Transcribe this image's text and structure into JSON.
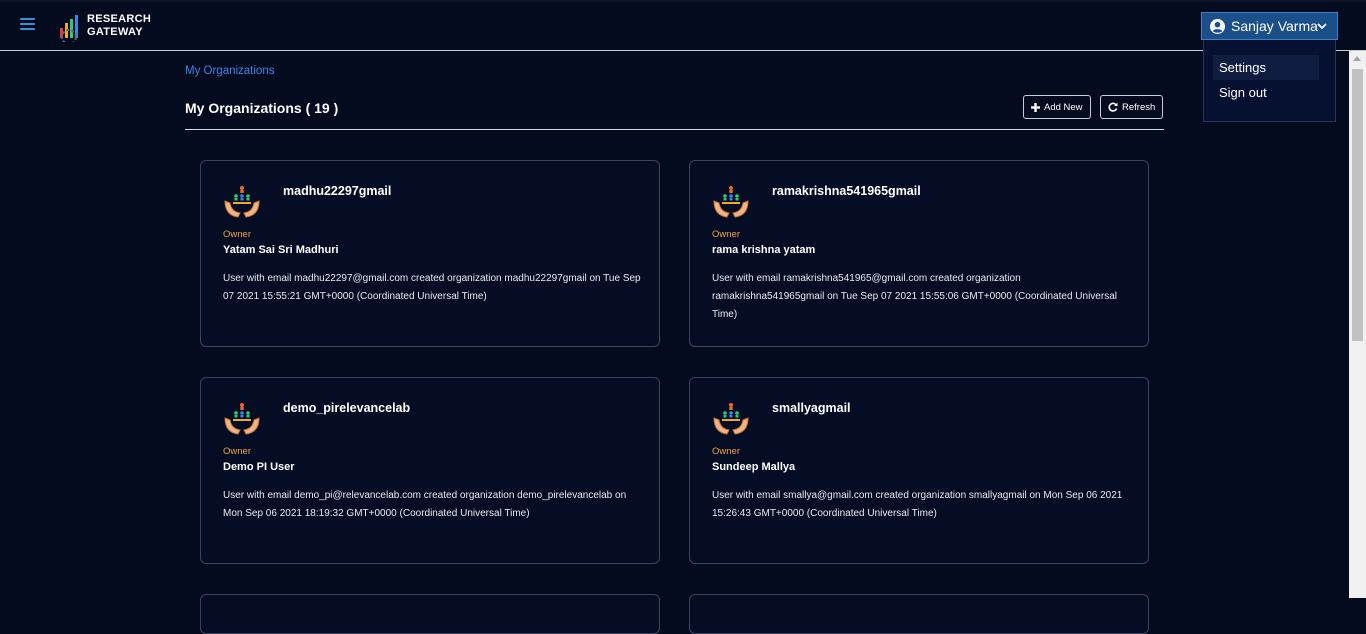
{
  "header": {
    "logo_line1": "RESEARCH",
    "logo_line2": "GATEWAY",
    "user_name": "Sanjay Varma",
    "menu_icon": "hamburger-menu-icon",
    "user_icon": "user-circle-icon"
  },
  "user_menu": {
    "items": [
      "Settings",
      "Sign out"
    ]
  },
  "breadcrumb": "My Organizations",
  "page_title": "My Organizations ( 19 )",
  "toolbar": {
    "add_label": "Add New",
    "refresh_label": "Refresh"
  },
  "organizations": [
    {
      "name": "madhu22297gmail",
      "role": "Owner",
      "owner": "Yatam Sai Sri Madhuri",
      "description": "User with email madhu22297@gmail.com created organization madhu22297gmail on Tue Sep 07 2021 15:55:21 GMT+0000 (Coordinated Universal Time)"
    },
    {
      "name": "ramakrishna541965gmail",
      "role": "Owner",
      "owner": "rama krishna yatam",
      "description": "User with email ramakrishna541965@gmail.com created organization ramakrishna541965gmail on Tue Sep 07 2021 15:55:06 GMT+0000 (Coordinated Universal Time)"
    },
    {
      "name": "demo_pirelevancelab",
      "role": "Owner",
      "owner": "Demo PI User",
      "description": "User with email demo_pi@relevancelab.com created organization demo_pirelevancelab on Mon Sep 06 2021 18:19:32 GMT+0000 (Coordinated Universal Time)"
    },
    {
      "name": "smallyagmail",
      "role": "Owner",
      "owner": "Sundeep Mallya",
      "description": "User with email smallya@gmail.com created organization smallyagmail on Mon Sep 06 2021 15:26:43 GMT+0000 (Coordinated Universal Time)"
    }
  ],
  "colors": {
    "background": "#040b1f",
    "accent": "#3a86e6",
    "owner_role": "#f2a33a",
    "user_button": "#1a4f8a"
  }
}
